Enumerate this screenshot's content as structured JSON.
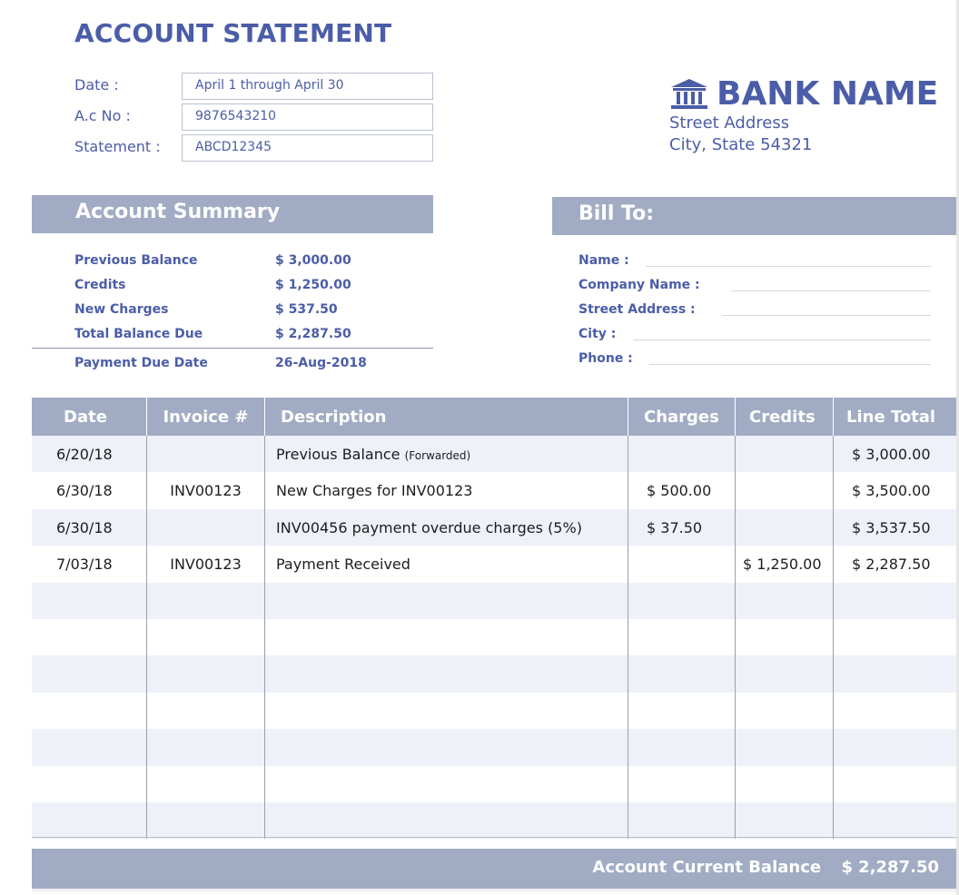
{
  "title": "ACCOUNT STATEMENT",
  "meta": [
    {
      "label": "Date :",
      "value": "April 1 through April 30"
    },
    {
      "label": "A.c No :",
      "value": "9876543210"
    },
    {
      "label": "Statement :",
      "value": "ABCD12345"
    }
  ],
  "bank": {
    "icon": "bank-building-icon",
    "name": "BANK NAME",
    "street": "Street Address",
    "city": "City, State 54321"
  },
  "summary": {
    "heading": "Account Summary",
    "items": [
      {
        "label": "Previous Balance",
        "value": "$ 3,000.00"
      },
      {
        "label": "Credits",
        "value": "$ 1,250.00"
      },
      {
        "label": "New Charges",
        "value": "$ 537.50"
      },
      {
        "label": "Total Balance Due",
        "value": "$ 2,287.50"
      }
    ],
    "due_label": "Payment Due Date",
    "due_value": "26-Aug-2018"
  },
  "bill_to": {
    "heading": "Bill To:",
    "fields": [
      "Name :",
      "Company Name :",
      "Street Address :",
      "City :",
      "Phone :"
    ]
  },
  "table": {
    "headers": [
      "Date",
      "Invoice #",
      "Description",
      "Charges",
      "Credits",
      "Line Total"
    ],
    "rows": [
      {
        "date": "6/20/18",
        "invoice": "",
        "description": "Previous Balance",
        "note": "(Forwarded)",
        "charges": "",
        "credits": "",
        "total": "$ 3,000.00"
      },
      {
        "date": "6/30/18",
        "invoice": "INV00123",
        "description": "New Charges for INV00123",
        "note": "",
        "charges": "$ 500.00",
        "credits": "",
        "total": "$ 3,500.00"
      },
      {
        "date": "6/30/18",
        "invoice": "",
        "description": "INV00456 payment overdue charges (5%)",
        "note": "",
        "charges": "$ 37.50",
        "credits": "",
        "total": "$ 3,537.50"
      },
      {
        "date": "7/03/18",
        "invoice": "INV00123",
        "description": "Payment Received",
        "note": "",
        "charges": "",
        "credits": "$ 1,250.00",
        "total": "$ 2,287.50"
      },
      {
        "date": "",
        "invoice": "",
        "description": "",
        "note": "",
        "charges": "",
        "credits": "",
        "total": ""
      },
      {
        "date": "",
        "invoice": "",
        "description": "",
        "note": "",
        "charges": "",
        "credits": "",
        "total": ""
      },
      {
        "date": "",
        "invoice": "",
        "description": "",
        "note": "",
        "charges": "",
        "credits": "",
        "total": ""
      },
      {
        "date": "",
        "invoice": "",
        "description": "",
        "note": "",
        "charges": "",
        "credits": "",
        "total": ""
      },
      {
        "date": "",
        "invoice": "",
        "description": "",
        "note": "",
        "charges": "",
        "credits": "",
        "total": ""
      },
      {
        "date": "",
        "invoice": "",
        "description": "",
        "note": "",
        "charges": "",
        "credits": "",
        "total": ""
      },
      {
        "date": "",
        "invoice": "",
        "description": "",
        "note": "",
        "charges": "",
        "credits": "",
        "total": ""
      }
    ]
  },
  "footer": {
    "label": "Account Current Balance",
    "value": "$ 2,287.50"
  },
  "colors": {
    "accent": "#4b5da8",
    "band": "#a1acc4",
    "row_alt": "#eef1f8"
  }
}
